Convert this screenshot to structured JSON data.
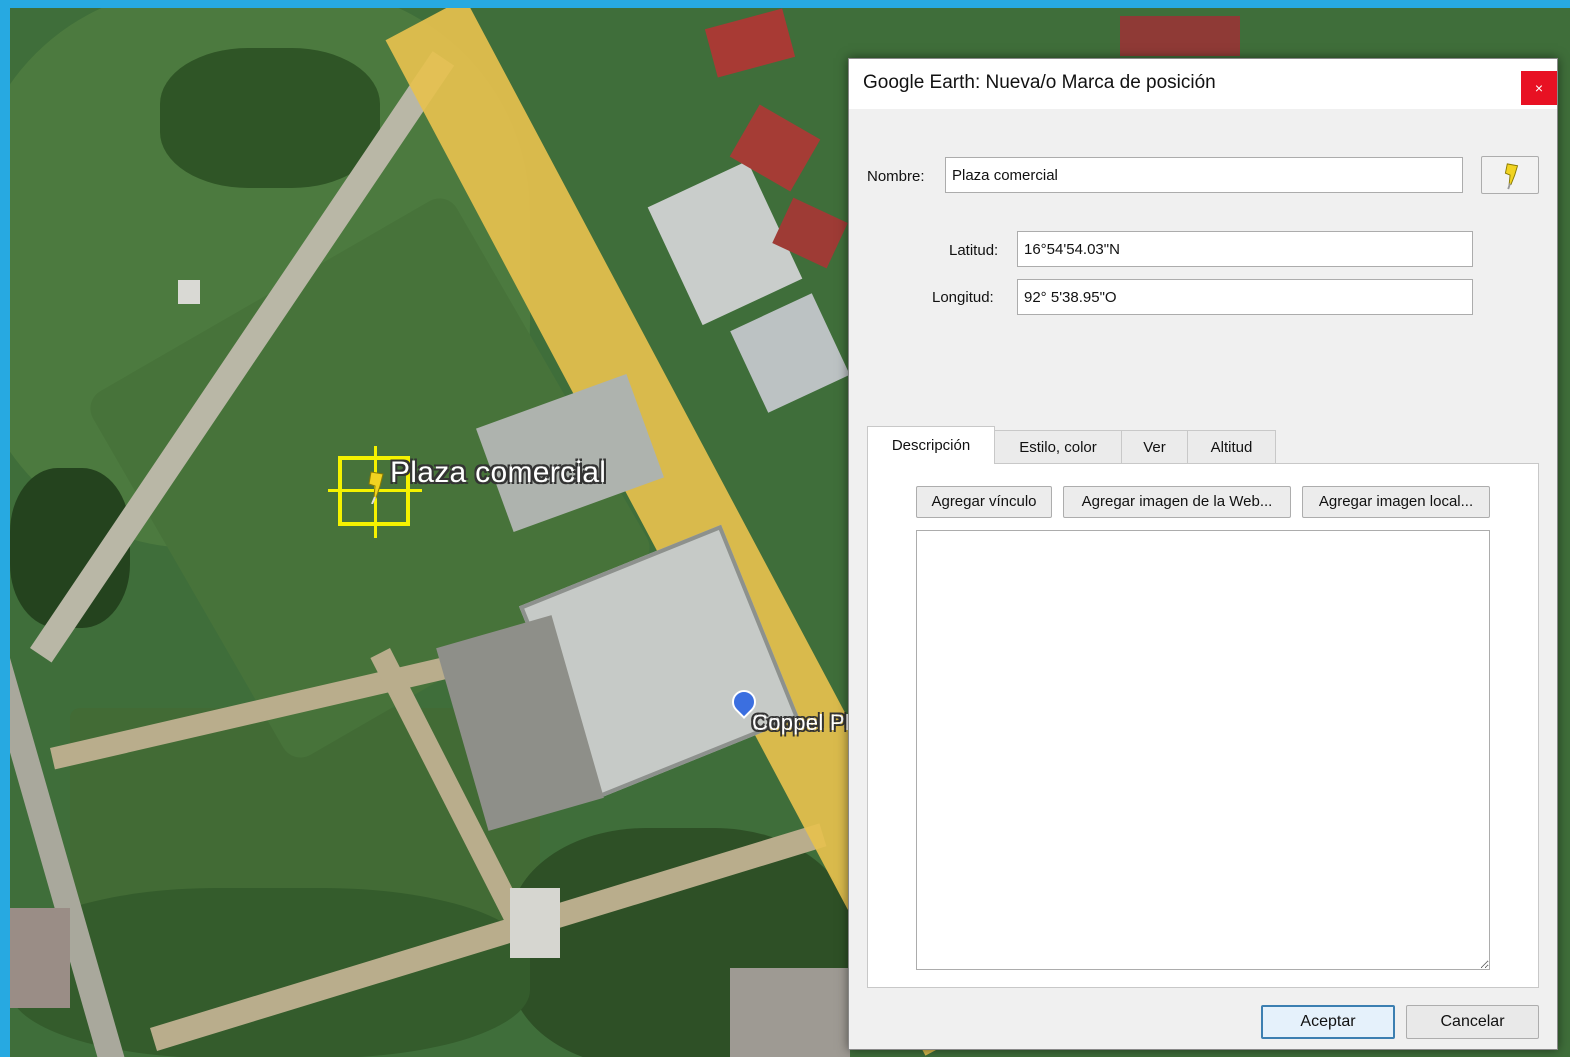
{
  "map": {
    "placemark_label": "Plaza comercial",
    "poi_label": "Coppel Pl"
  },
  "dialog": {
    "title": "Google Earth: Nueva/o Marca de posición",
    "close_label": "×",
    "name_label": "Nombre:",
    "name_value": "Plaza comercial",
    "lat_label": "Latitud:",
    "lat_value": "16°54'54.03\"N",
    "lon_label": "Longitud:",
    "lon_value": "92° 5'38.95\"O",
    "tabs": [
      {
        "label": "Descripción",
        "active": true
      },
      {
        "label": "Estilo, color",
        "active": false
      },
      {
        "label": "Ver",
        "active": false
      },
      {
        "label": "Altitud",
        "active": false
      }
    ],
    "panel_buttons": [
      "Agregar vínculo",
      "Agregar imagen de la Web...",
      "Agregar imagen local..."
    ],
    "description_value": "",
    "ok_label": "Aceptar",
    "cancel_label": "Cancelar"
  },
  "colors": {
    "accent_close": "#e81123",
    "placemark_yellow": "#f5f200",
    "frame_blue": "#27a9e1"
  }
}
